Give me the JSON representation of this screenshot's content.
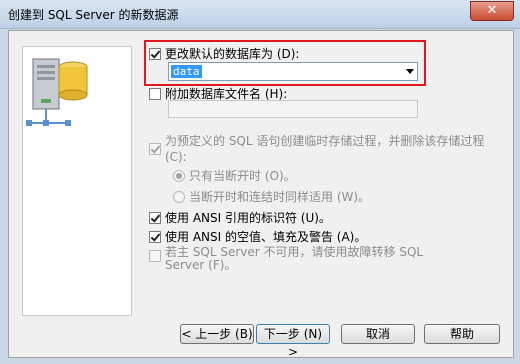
{
  "window": {
    "title": "创建到 SQL Server 的新数据源",
    "close_glyph": "✕"
  },
  "options": {
    "change_default_db_label": "更改默认的数据库为 (D):",
    "default_db_value": "data",
    "attach_db_filename_label": "附加数据库文件名 (H):",
    "create_temp_sp_label": "为预定义的 SQL 语句创建临时存储过程，并删除该存储过程 (C):",
    "only_on_disconnect_label": "只有当断开时 (O)。",
    "on_disconnect_and_connect_label": "当断开时和连结时同样适用 (W)。",
    "ansi_quoted_identifiers_label": "使用 ANSI 引用的标识符 (U)。",
    "ansi_nulls_label": "使用 ANSI 的空值、填充及警告 (A)。",
    "failover_line1": "若主 SQL Server 不可用，请使用故障转移 SQL",
    "failover_line2": "Server (F)。"
  },
  "buttons": {
    "back": "< 上一步 (B)",
    "next": "下一步 (N) >",
    "cancel": "取消",
    "help": "帮助"
  },
  "colors": {
    "highlight_border": "#e0191f",
    "selection": "#3399ff"
  },
  "icons": {
    "art": "database-server-icon"
  }
}
